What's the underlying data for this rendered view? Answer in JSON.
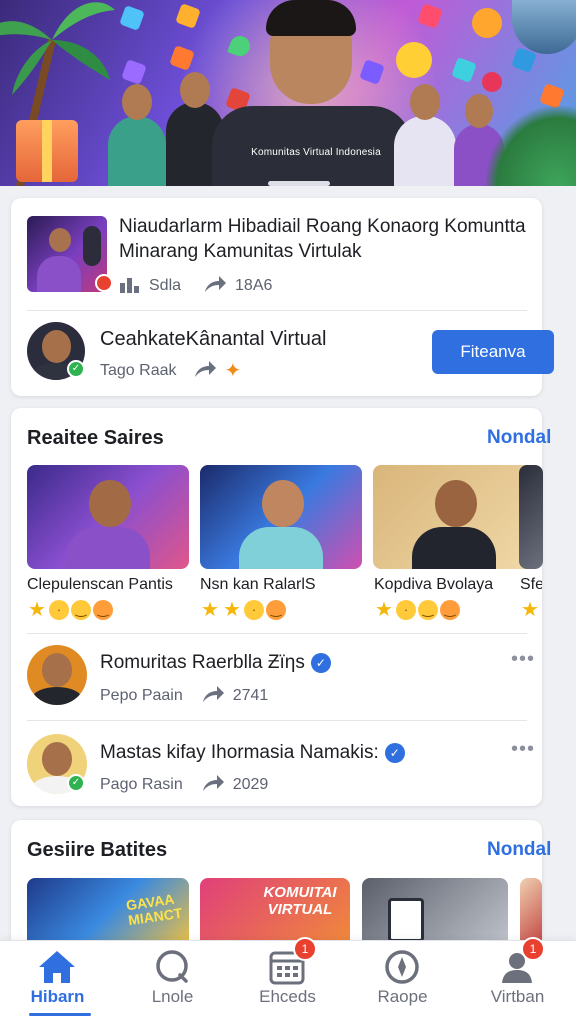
{
  "hero": {
    "caption": "Komunitas Virtual Indonesia"
  },
  "featured_card": {
    "title": "Niaudarlarm Hibadiail Roang Konaorg Komuntta Minarang Kamunitas Virtulak",
    "meta_label": "Sdla",
    "meta_count": "18A6",
    "host_name": "CeahkateKânantal Virtual",
    "host_sub": "Tago Raak",
    "action_label": "Fiteanva"
  },
  "section_1": {
    "title": "Reaitee Saires",
    "link": "Nondal",
    "tiles": [
      {
        "name": "Clepulenscan Pantis"
      },
      {
        "name": "Nsn kan RalarlS"
      },
      {
        "name": "Kopdiva Bvolaya"
      },
      {
        "name": "Sfedial Ir"
      }
    ],
    "posts": [
      {
        "title": "Romuritas Raerblla Ƶïƞs",
        "author": "Pepo Paain",
        "count": "2741",
        "more": "•••"
      },
      {
        "title": "Mastas kifay Ihormasia  Namakis:",
        "author": "Pago Rasin",
        "count": "2029",
        "more": "•••"
      }
    ]
  },
  "section_2": {
    "title": "Gesiire Batites",
    "link": "Nondal",
    "tiles": [
      {
        "name": "GAVAA MIANCT"
      },
      {
        "name": "KOMUITAI VIRTUAL"
      },
      {
        "name": ""
      },
      {
        "name": ""
      }
    ]
  },
  "bottom_nav": {
    "items": [
      {
        "label": "Hibarn",
        "icon": "home-icon",
        "badge": ""
      },
      {
        "label": "Lnole",
        "icon": "search-icon",
        "badge": ""
      },
      {
        "label": "Ehceds",
        "icon": "calendar-icon",
        "badge": "1"
      },
      {
        "label": "Raope",
        "icon": "compass-icon",
        "badge": ""
      },
      {
        "label": "Virtban",
        "icon": "profile-icon",
        "badge": "1"
      }
    ]
  },
  "colors": {
    "accent": "#2f6fe0",
    "notification": "#e9412f",
    "online": "#2fb351"
  }
}
